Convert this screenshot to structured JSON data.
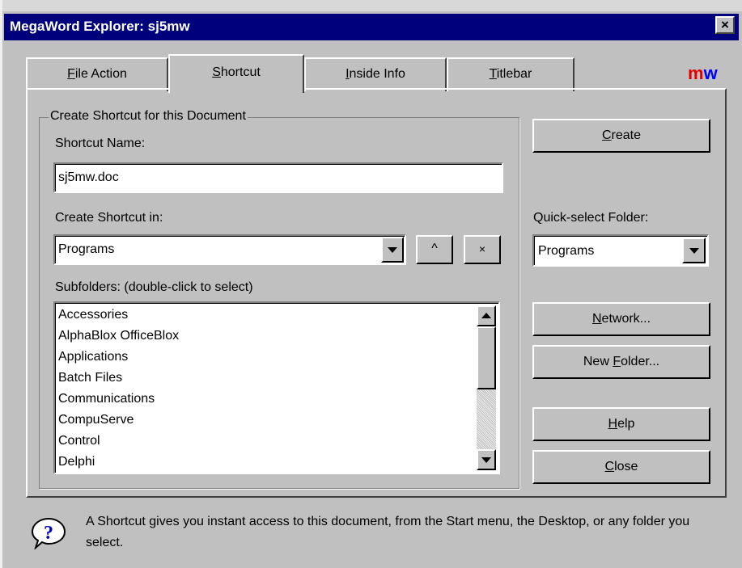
{
  "window": {
    "title": "MegaWord Explorer: sj5mw",
    "close_glyph": "×"
  },
  "logo": {
    "m": "m",
    "w": "w",
    "m_color": "#e00000",
    "w_color": "#0000ff"
  },
  "tabs": [
    {
      "label": "File Action",
      "mnemonic": "F",
      "rest": "ile Action",
      "active": false
    },
    {
      "label": "Shortcut",
      "mnemonic": "S",
      "rest": "hortcut",
      "active": true
    },
    {
      "label": "Inside Info",
      "mnemonic": "I",
      "rest": "nside Info",
      "active": false
    },
    {
      "label": "Titlebar",
      "mnemonic": "T",
      "rest": "itlebar",
      "active": false
    }
  ],
  "group": {
    "title": "Create Shortcut for this Document",
    "name_label": "Shortcut Name:",
    "name_value": "sj5mw.doc",
    "in_label": "Create Shortcut in:",
    "in_value": "Programs",
    "up_button": "^",
    "close_button": "×",
    "subfolders_label": "Subfolders: (double-click to select)",
    "subfolders": [
      "Accessories",
      "AlphaBlox OfficeBlox",
      "Applications",
      "Batch Files",
      "Communications",
      "CompuServe",
      "Control",
      "Delphi"
    ]
  },
  "right": {
    "create_button": {
      "mnemonic": "C",
      "rest": "reate"
    },
    "quick_label": "Quick-select Folder:",
    "quick_value": "Programs",
    "network_button": {
      "mnemonic": "N",
      "rest": "etwork...",
      "label": "Network..."
    },
    "newfolder_button": {
      "pre": "New ",
      "mnemonic": "F",
      "rest": "older...",
      "label": "New Folder..."
    },
    "help_button": {
      "mnemonic": "H",
      "rest": "elp"
    },
    "close_button": {
      "mnemonic": "C",
      "rest": "lose"
    }
  },
  "footer": {
    "icon": "question-bubble-icon",
    "text": "A Shortcut gives you instant access to this document, from the Start menu, the Desktop, or any folder you select."
  }
}
